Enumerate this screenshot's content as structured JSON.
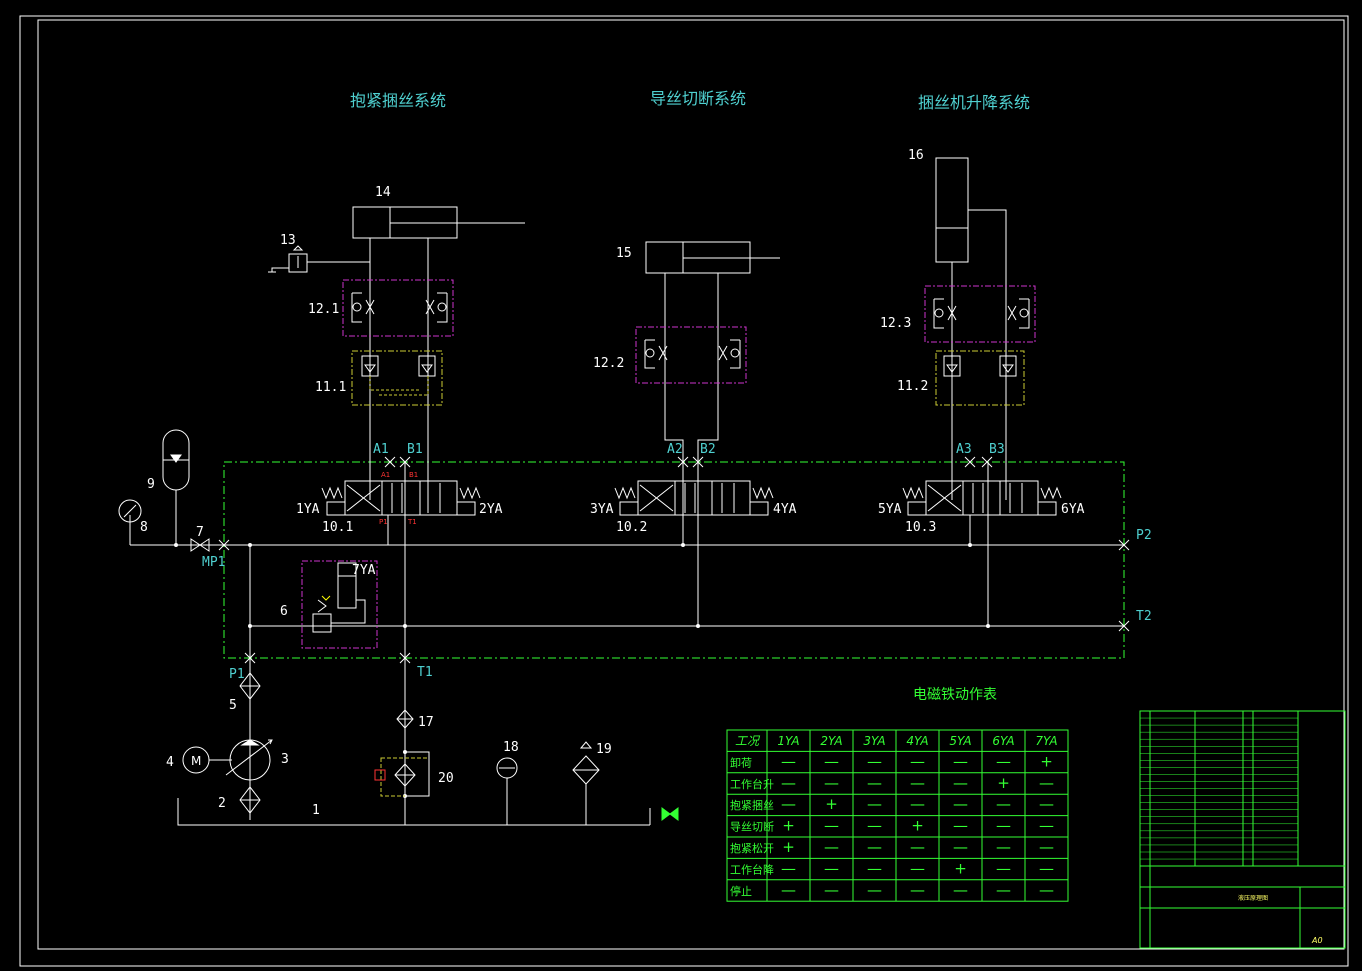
{
  "titles": {
    "system1": "抱紧捆丝系统",
    "system2": "导丝切断系统",
    "system3": "捆丝机升降系统",
    "table_title": "电磁铁动作表"
  },
  "components": {
    "c1": "1",
    "c2": "2",
    "c3": "3",
    "c4": "4",
    "c5": "5",
    "c6": "6",
    "c7": "7",
    "c8": "8",
    "c9": "9",
    "c10_1": "10.1",
    "c10_2": "10.2",
    "c10_3": "10.3",
    "c11_1": "11.1",
    "c11_2": "11.2",
    "c12_1": "12.1",
    "c12_2": "12.2",
    "c12_3": "12.3",
    "c13": "13",
    "c14": "14",
    "c15": "15",
    "c16": "16",
    "c17": "17",
    "c18": "18",
    "c19": "19",
    "c20": "20",
    "motor": "M"
  },
  "ports": {
    "A1": "A1",
    "B1": "B1",
    "A2": "A2",
    "B2": "B2",
    "A3": "A3",
    "B3": "B3",
    "P1": "P1",
    "T1": "T1",
    "P2": "P2",
    "T2": "T2",
    "MP1": "MP1"
  },
  "solenoids": {
    "s1": "1YA",
    "s2": "2YA",
    "s3": "3YA",
    "s4": "4YA",
    "s5": "5YA",
    "s6": "6YA",
    "s7": "7YA"
  },
  "valve_tags": {
    "A": "A1",
    "B": "B1",
    "P": "P1",
    "T": "T1"
  },
  "solenoid_table": {
    "corner": "工况",
    "columns": [
      "1YA",
      "2YA",
      "3YA",
      "4YA",
      "5YA",
      "6YA",
      "7YA"
    ],
    "rows": [
      {
        "name": "卸荷",
        "cells": [
          "—",
          "—",
          "—",
          "—",
          "—",
          "—",
          "+"
        ]
      },
      {
        "name": "工作台升",
        "cells": [
          "—",
          "—",
          "—",
          "—",
          "—",
          "+",
          "—"
        ]
      },
      {
        "name": "抱紧捆丝",
        "cells": [
          "—",
          "+",
          "—",
          "—",
          "—",
          "—",
          "—"
        ]
      },
      {
        "name": "导丝切断",
        "cells": [
          "+",
          "—",
          "—",
          "+",
          "—",
          "—",
          "—"
        ]
      },
      {
        "name": "抱紧松开",
        "cells": [
          "+",
          "—",
          "—",
          "—",
          "—",
          "—",
          "—"
        ]
      },
      {
        "name": "工作台降",
        "cells": [
          "—",
          "—",
          "—",
          "—",
          "+",
          "—",
          "—"
        ]
      },
      {
        "name": "停止",
        "cells": [
          "—",
          "—",
          "—",
          "—",
          "—",
          "—",
          "—"
        ]
      }
    ]
  },
  "title_block": {
    "drawing_name": "液压原理图",
    "sheet_size": "A0"
  },
  "colors": {
    "line": "#ffffff",
    "text_cyan": "#4fd0d0",
    "green": "#33ff33",
    "magenta": "#cc33cc",
    "yellow": "#cccc33",
    "red": "#ff3333"
  }
}
